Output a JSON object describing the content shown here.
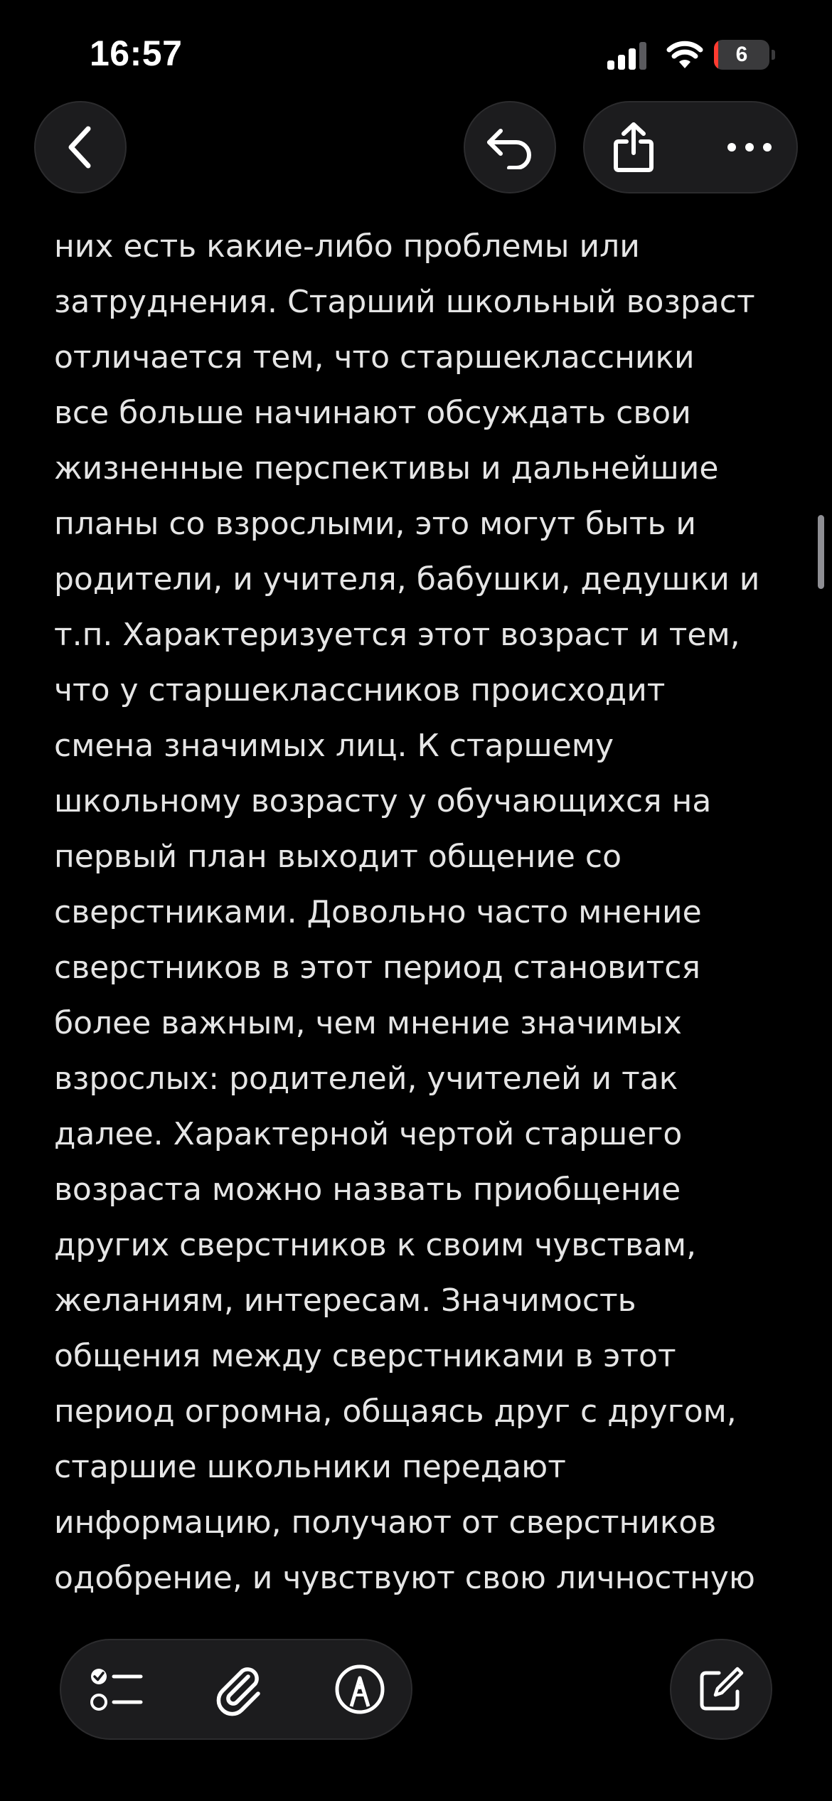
{
  "status_bar": {
    "time": "16:57",
    "battery_level": "6",
    "battery_fraction": 0.06,
    "battery_color": "#ff3b30",
    "icons": [
      "signal-icon",
      "wifi-icon",
      "battery-icon"
    ]
  },
  "nav_bar": {
    "icons": [
      "chevron-left-icon",
      "undo-icon",
      "share-icon",
      "more-icon"
    ]
  },
  "note": {
    "lines": [
      "них есть какие-либо проблемы или",
      "затруднения. Старший школьный возраст",
      "отличается тем, что старшеклассники",
      "все больше начинают обсуждать свои",
      "жизненные перспективы и дальнейшие",
      "планы со взрослыми, это могут быть и",
      "родители, и учителя, бабушки, дедушки и",
      "т.п. Характеризуется этот возраст и тем,",
      "что у старшеклассников происходит",
      "смена значимых лиц. К старшему",
      "школьному возрасту у обучающихся на",
      "первый план выходит общение со",
      "сверстниками. Довольно часто мнение",
      "сверстников в этот период становится",
      "более важным, чем мнение значимых",
      "взрослых: родителей, учителей и так",
      "далее. Характерной чертой старшего",
      "возраста можно назвать приобщение",
      "других сверстников к своим чувствам,",
      "желаниям, интересам. Значимость",
      "общения между сверстниками в этот",
      "период огромна, общаясь друг с другом,",
      "старшие школьники передают",
      "информацию, получают от сверстников",
      "одобрение, и чувствуют свою личностную"
    ]
  },
  "toolbar": {
    "icons": [
      "checklist-icon",
      "paperclip-icon",
      "markup-pen-icon",
      "compose-icon"
    ]
  },
  "colors": {
    "background": "#000000",
    "text": "#e5e5e5",
    "button_fill": "#1c1c1e",
    "button_border": "#2c2c2e"
  }
}
